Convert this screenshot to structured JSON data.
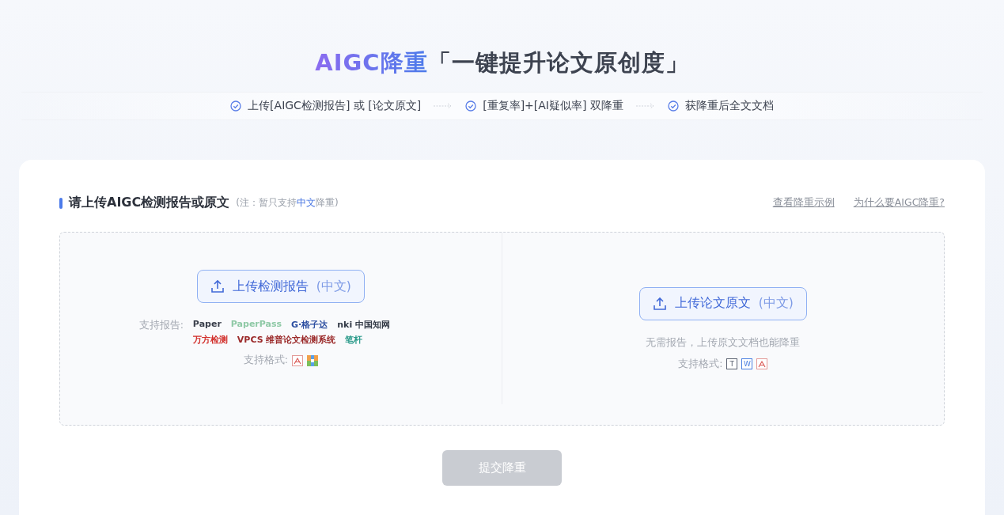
{
  "header": {
    "title_accent": "AIGC降重",
    "title_rest": "「一键提升论文原创度」"
  },
  "steps": [
    {
      "label": "上传[AIGC检测报告] 或 [论文原文]"
    },
    {
      "label": "[重复率]+[AI疑似率] 双降重"
    },
    {
      "label": "获降重后全文文档"
    }
  ],
  "section": {
    "title": "请上传AIGC检测报告或原文",
    "note": "(注：暂只支持**中文**降重)",
    "links": [
      "查看降重示例",
      "为什么要AIGC降重?"
    ]
  },
  "panels": [
    {
      "kind": "report",
      "button": "上传检测报告",
      "button_suffix": "(中文)",
      "reports_label": "支持报告:",
      "logos": [
        {
          "text": "Paper",
          "color": "#3a3f4b"
        },
        {
          "text": "PaperPass",
          "color": "#8fc9a6"
        },
        {
          "text": "G·格子达",
          "color": "#2b4da0"
        },
        {
          "text": "nki 中国知网",
          "color": "#333a46"
        },
        {
          "text": "万方检测",
          "color": "#d2302c"
        },
        {
          "text": "VPCS 维普论文检测系统",
          "color": "#9b2a2a"
        },
        {
          "text": "笔杆",
          "color": "#2a9a8a"
        }
      ],
      "formats_label": "支持格式:",
      "formats": [
        {
          "kind": "pdf"
        },
        {
          "kind": "zip"
        }
      ]
    },
    {
      "kind": "original",
      "button": "上传论文原文",
      "button_suffix": "(中文)",
      "hint": "无需报告，上传原文文档也能降重",
      "formats_label": "支持格式:",
      "formats": [
        {
          "kind": "letter",
          "letter": "T",
          "color": "#5a6170"
        },
        {
          "kind": "letter",
          "letter": "W",
          "color": "#4a7fe0"
        },
        {
          "kind": "pdf"
        }
      ]
    }
  ],
  "submit": {
    "label": "提交降重",
    "disabled": true
  }
}
